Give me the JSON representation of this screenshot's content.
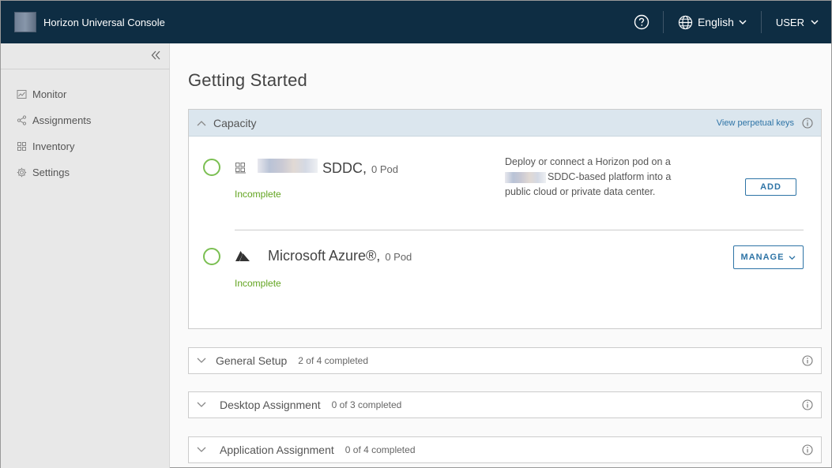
{
  "header": {
    "app_title": "Horizon Universal Console",
    "language": "English",
    "user": "USER"
  },
  "sidebar": {
    "items": [
      {
        "label": "Monitor",
        "icon": "monitor-icon"
      },
      {
        "label": "Assignments",
        "icon": "share-icon"
      },
      {
        "label": "Inventory",
        "icon": "grid-icon"
      },
      {
        "label": "Settings",
        "icon": "gear-icon"
      }
    ]
  },
  "main": {
    "page_title": "Getting Started",
    "capacity": {
      "title": "Capacity",
      "view_keys": "View perpetual keys",
      "pods": [
        {
          "name": "SDDC,",
          "count": "0 Pod",
          "status": "Incomplete",
          "desc_line1": "Deploy or connect a Horizon pod on a",
          "desc_line2": "SDDC-based platform into a",
          "desc_line3": "public cloud or private data center.",
          "button": "ADD"
        },
        {
          "name": "Microsoft Azure®,",
          "count": "0 Pod",
          "status": "Incomplete",
          "button": "MANAGE"
        }
      ]
    },
    "sections": [
      {
        "title": "General Setup",
        "status": "2 of 4 completed"
      },
      {
        "title": "Desktop Assignment",
        "status": "0 of 3 completed"
      },
      {
        "title": "Application Assignment",
        "status": "0 of 4 completed"
      }
    ]
  },
  "colors": {
    "header_bg": "#0e2d43",
    "accent": "#2e74a6",
    "complete_green": "#62a420"
  }
}
